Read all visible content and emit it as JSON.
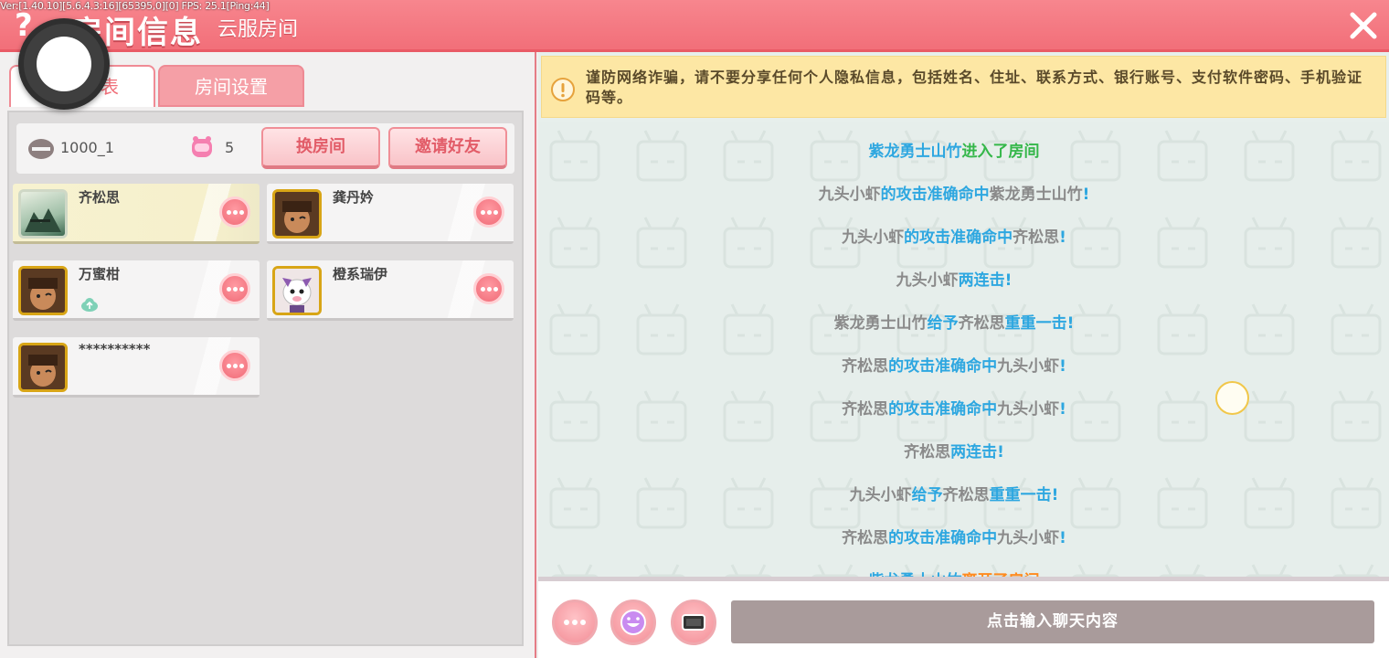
{
  "header": {
    "version_text": "Ver:[1.40.10][5.6.4.3:16][65395,0][0] FPS: 25.1[Ping:44]",
    "help_icon_text": "?",
    "title": "房间信息",
    "subtitle": "云服房间"
  },
  "tabs": [
    {
      "label": "表"
    },
    {
      "label": "房间设置"
    }
  ],
  "room": {
    "id": "1000_1",
    "player_count": "5",
    "change_room_label": "换房间",
    "invite_friends_label": "邀请好友"
  },
  "players": [
    {
      "name": "齐松思"
    },
    {
      "name": "龚丹妗"
    },
    {
      "name": "万蜜柑"
    },
    {
      "name": "橙系瑞伊"
    },
    {
      "name": "**********"
    }
  ],
  "notice": {
    "text": "谨防网络诈骗，请不要分享任何个人隐私信息，包括姓名、住址、联系方式、银行账号、支付软件密码、手机验证码等。"
  },
  "chat": {
    "messages": [
      {
        "parts": [
          {
            "t": "紫龙勇士山竹",
            "c": "b"
          },
          {
            "t": "进入了房间",
            "c": "gr"
          }
        ]
      },
      {
        "parts": [
          {
            "t": "九头小虾",
            "c": "g"
          },
          {
            "t": "的攻击准确命中",
            "c": "b"
          },
          {
            "t": "紫龙勇士山竹",
            "c": "g"
          },
          {
            "t": "!",
            "c": "b"
          }
        ]
      },
      {
        "parts": [
          {
            "t": "九头小虾",
            "c": "g"
          },
          {
            "t": "的攻击准确命中",
            "c": "b"
          },
          {
            "t": "齐松思",
            "c": "g"
          },
          {
            "t": "!",
            "c": "b"
          }
        ]
      },
      {
        "parts": [
          {
            "t": "九头小虾",
            "c": "g"
          },
          {
            "t": "两连击",
            "c": "b"
          },
          {
            "t": "!",
            "c": "b"
          }
        ]
      },
      {
        "parts": [
          {
            "t": "紫龙勇士山竹",
            "c": "g"
          },
          {
            "t": "给予",
            "c": "b"
          },
          {
            "t": "齐松思",
            "c": "g"
          },
          {
            "t": "重重一击",
            "c": "b"
          },
          {
            "t": "!",
            "c": "b"
          }
        ]
      },
      {
        "parts": [
          {
            "t": "齐松思",
            "c": "g"
          },
          {
            "t": "的攻击准确命中",
            "c": "b"
          },
          {
            "t": "九头小虾",
            "c": "g"
          },
          {
            "t": "!",
            "c": "b"
          }
        ]
      },
      {
        "parts": [
          {
            "t": "齐松思",
            "c": "g"
          },
          {
            "t": "的攻击准确命中",
            "c": "b"
          },
          {
            "t": "九头小虾",
            "c": "g"
          },
          {
            "t": "!",
            "c": "b"
          }
        ]
      },
      {
        "parts": [
          {
            "t": "齐松思",
            "c": "g"
          },
          {
            "t": "两连击",
            "c": "b"
          },
          {
            "t": "!",
            "c": "b"
          }
        ]
      },
      {
        "parts": [
          {
            "t": "九头小虾",
            "c": "g"
          },
          {
            "t": "给予",
            "c": "b"
          },
          {
            "t": "齐松思",
            "c": "g"
          },
          {
            "t": "重重一击",
            "c": "b"
          },
          {
            "t": "!",
            "c": "b"
          }
        ]
      },
      {
        "parts": [
          {
            "t": "齐松思",
            "c": "g"
          },
          {
            "t": "的攻击准确命中",
            "c": "b"
          },
          {
            "t": "九头小虾",
            "c": "g"
          },
          {
            "t": "!",
            "c": "b"
          }
        ]
      },
      {
        "parts": [
          {
            "t": "紫龙勇士山竹",
            "c": "b"
          },
          {
            "t": "离开了房间",
            "c": "o"
          }
        ]
      }
    ],
    "input_placeholder": "点击输入聊天内容"
  },
  "colors": {
    "header": "#f26f79",
    "name_gray": "#8a8a8a",
    "action_blue": "#2ea7e0",
    "enter_green": "#35b74a",
    "leave_orange": "#ff8a1e",
    "notice_bg": "#fde7a4"
  }
}
